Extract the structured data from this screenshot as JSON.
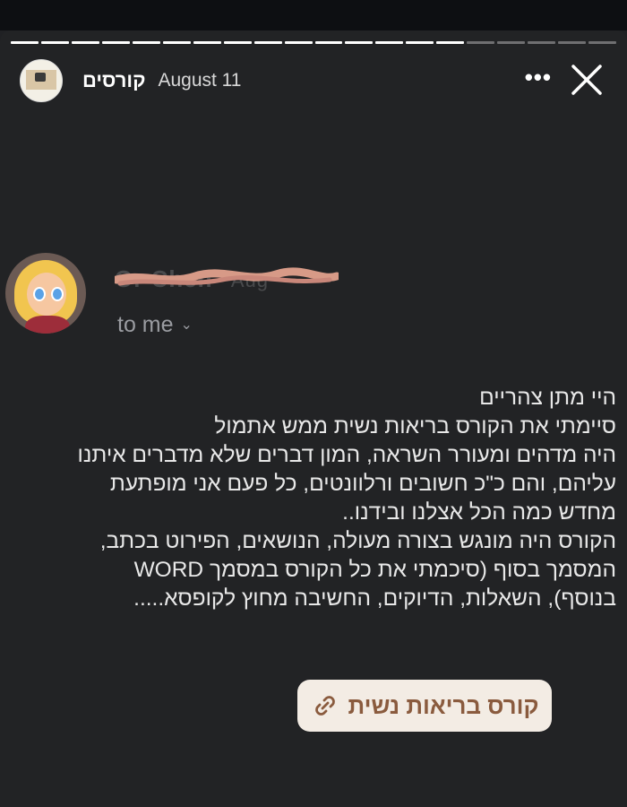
{
  "story": {
    "account_name": "קורסים",
    "date": "August 11",
    "progress": {
      "total_segments": 20,
      "current_index": 15
    }
  },
  "email": {
    "sender_name_obscured": "Or Chen",
    "sender_meta_obscured": "Aug",
    "recipient": "to me",
    "lines": [
      "היי מתן צהריים",
      "סיימתי את הקורס בריאות נשית ממש אתמול",
      "היה מדהים ומעורר השראה, המון דברים שלא מדברים איתנו",
      "עליהם, והם כ\"כ חשובים ורלוונטים, כל פעם אני מופתעת",
      "מחדש כמה הכל אצלנו ובידנו..",
      "הקורס היה מונגש בצורה מעולה, הנושאים, הפירוט בכתב,",
      "המסמך בסוף (סיכמתי את כל הקורס במסמך WORD",
      "בנוסף), השאלות, הדיוקים, החשיבה מחוץ לקופסא....."
    ]
  },
  "link_sticker": {
    "label": "קורס בריאות נשית",
    "icon": "link-icon",
    "color": "#8a5b3e",
    "background": "#f3ece4"
  },
  "icons": {
    "more": "more-dots-icon",
    "close": "close-icon",
    "chevron": "chevron-down-icon"
  }
}
